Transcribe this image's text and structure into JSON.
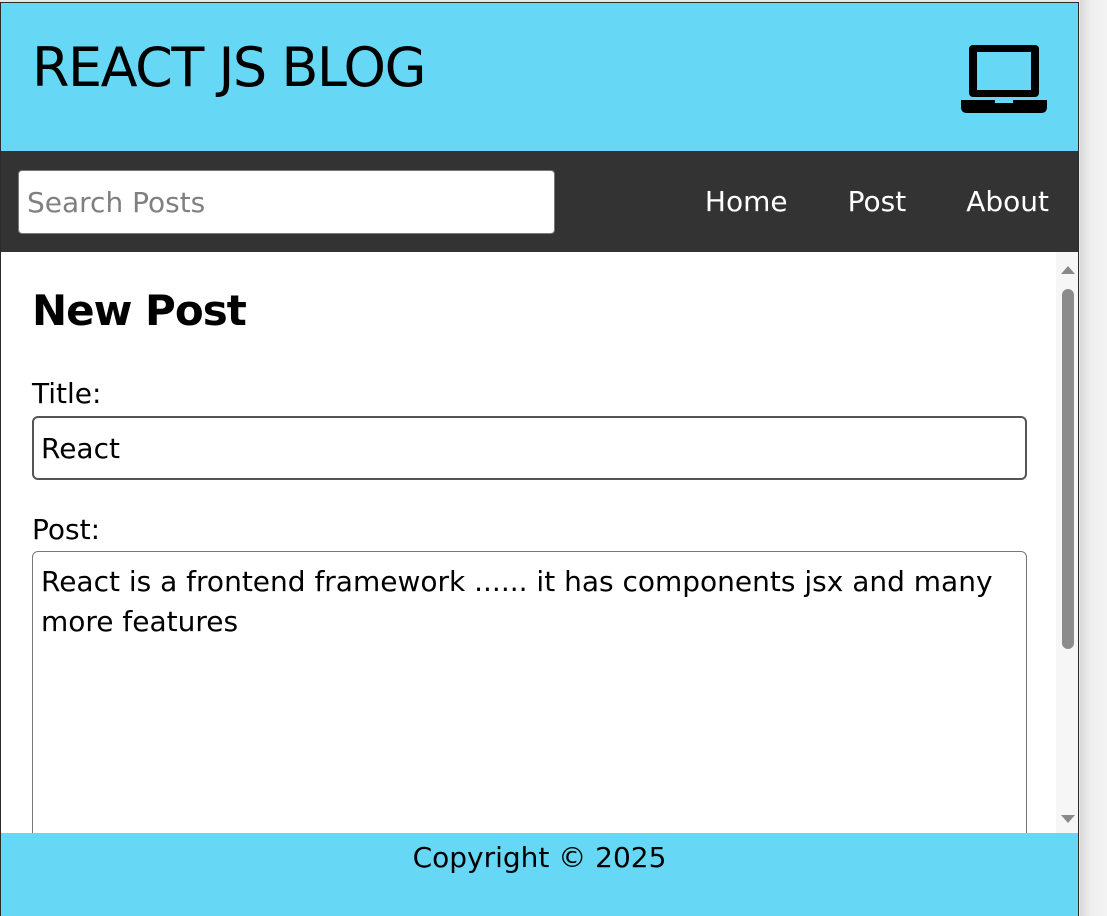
{
  "header": {
    "title": "REACT JS BLOG",
    "icon": "laptop-icon"
  },
  "nav": {
    "search_placeholder": "Search Posts",
    "search_value": "",
    "links": [
      {
        "label": "Home"
      },
      {
        "label": "Post"
      },
      {
        "label": "About"
      }
    ]
  },
  "main": {
    "page_title": "New Post",
    "title_label": "Title:",
    "title_value": "React",
    "post_label": "Post:",
    "post_value": "React is a frontend framework ...... it has components jsx and many more features"
  },
  "footer": {
    "copyright": "Copyright © 2025"
  },
  "colors": {
    "header_bg": "#66d8f5",
    "nav_bg": "#333333",
    "footer_bg": "#66d8f5"
  }
}
